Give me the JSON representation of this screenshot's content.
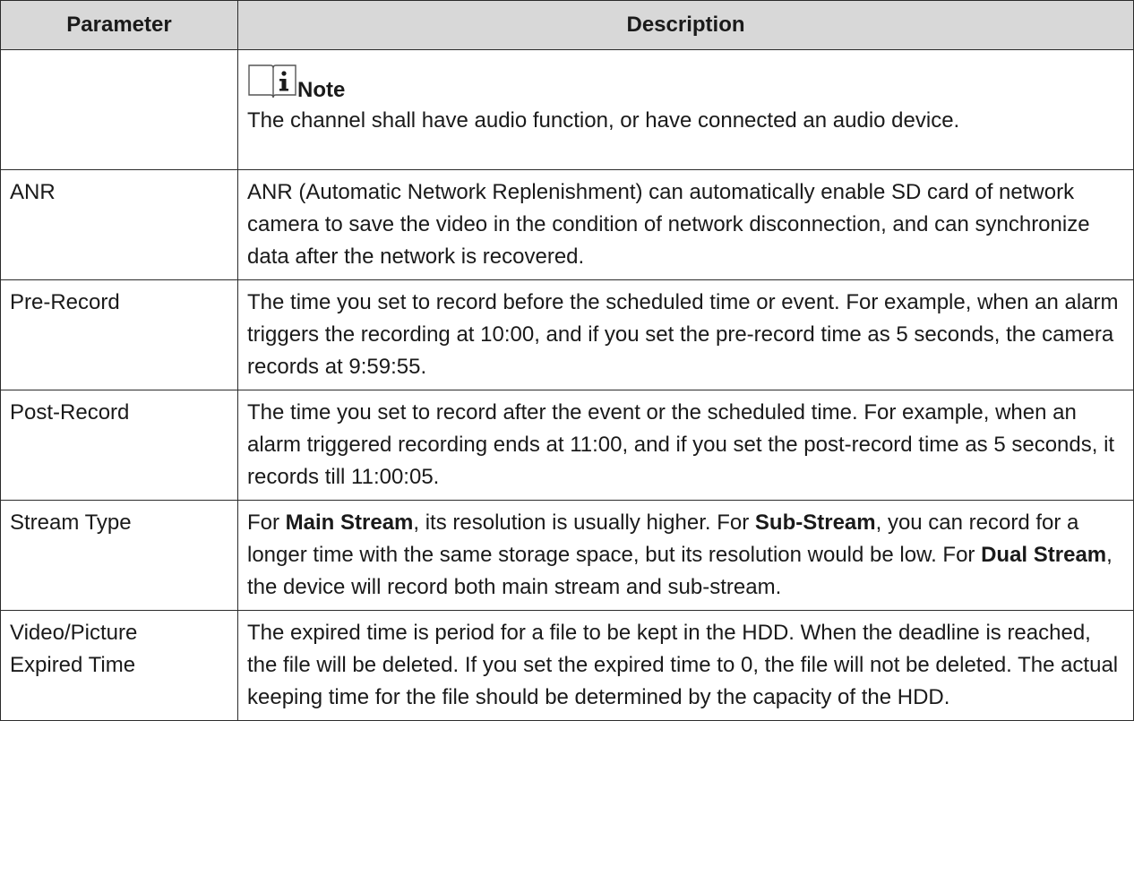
{
  "table": {
    "headers": {
      "parameter": "Parameter",
      "description": "Description"
    },
    "note": {
      "title": "Note",
      "icon": "info-book-icon",
      "text": "The channel shall have audio function, or have connected an audio device."
    },
    "rows": [
      {
        "parameter": "ANR",
        "description": "ANR (Automatic Network Replenishment) can automatically enable SD card of network camera to save the video in the condition of network disconnection, and can synchronize data after the network is recovered."
      },
      {
        "parameter": "Pre-Record",
        "description": "The time you set to record before the scheduled time or event. For example, when an alarm triggers the recording at 10:00, and if you set the pre-record time as 5 seconds, the camera records at 9:59:55."
      },
      {
        "parameter": "Post-Record",
        "description": "The time you set to record after the event or the scheduled time. For example, when an alarm triggered recording ends at 11:00, and if you set the post-record time as 5 seconds, it records till 11:00:05."
      },
      {
        "parameter": "Stream Type",
        "description_parts": [
          {
            "text": "For ",
            "bold": false
          },
          {
            "text": "Main Stream",
            "bold": true
          },
          {
            "text": ", its resolution is usually higher. For ",
            "bold": false
          },
          {
            "text": "Sub-Stream",
            "bold": true
          },
          {
            "text": ", you can record for a longer time with the same storage space, but its resolution would be low. For ",
            "bold": false
          },
          {
            "text": "Dual Stream",
            "bold": true
          },
          {
            "text": ", the device will record both main stream and sub-stream.",
            "bold": false
          }
        ]
      },
      {
        "parameter_lines": [
          "Video/Picture",
          "Expired Time"
        ],
        "description": "The expired time is period for a file to be kept in the HDD. When the deadline is reached, the file will be deleted. If you set the expired time to 0, the file will not be deleted. The actual keeping time for the file should be determined by the capacity of the HDD."
      }
    ]
  }
}
